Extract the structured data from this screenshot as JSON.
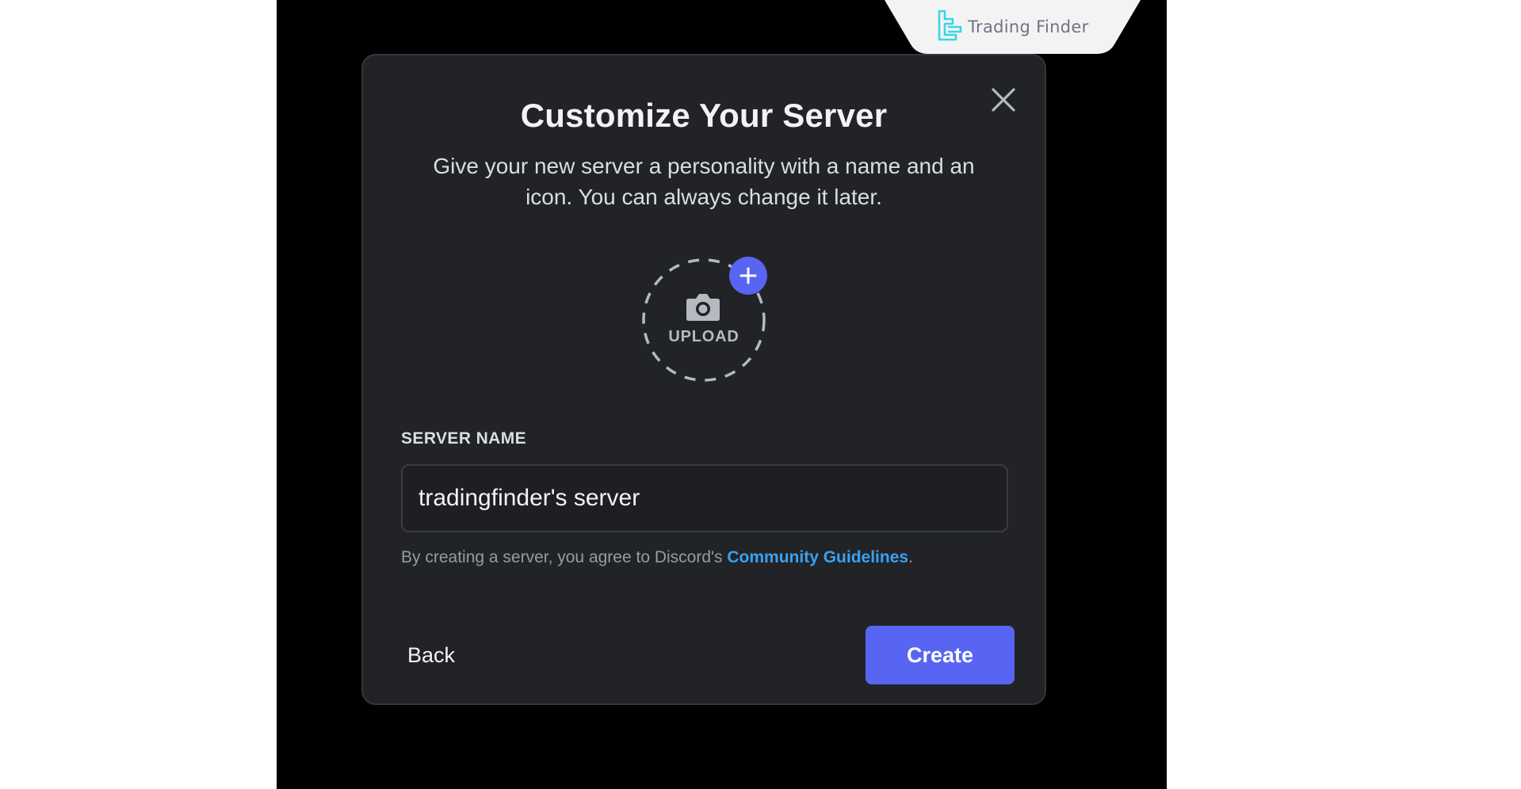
{
  "brand": {
    "name": "Trading Finder",
    "logo_icon": "trading-finder-logo-icon",
    "accent": "#37d6e6"
  },
  "modal": {
    "title": "Customize Your Server",
    "subtitle": "Give your new server a personality with a name and an icon. You can always change it later.",
    "close_icon": "close-icon",
    "upload": {
      "label": "UPLOAD",
      "icon": "camera-icon",
      "badge_icon": "plus-icon"
    },
    "server_name": {
      "label": "SERVER NAME",
      "value": "tradingfinder's server"
    },
    "terms": {
      "prefix": "By creating a server, you agree to Discord's ",
      "link": "Community Guidelines",
      "suffix": "."
    },
    "buttons": {
      "back": "Back",
      "create": "Create"
    }
  },
  "colors": {
    "modal_bg": "#222327",
    "primary": "#5865f2",
    "link": "#3aa1ef"
  }
}
